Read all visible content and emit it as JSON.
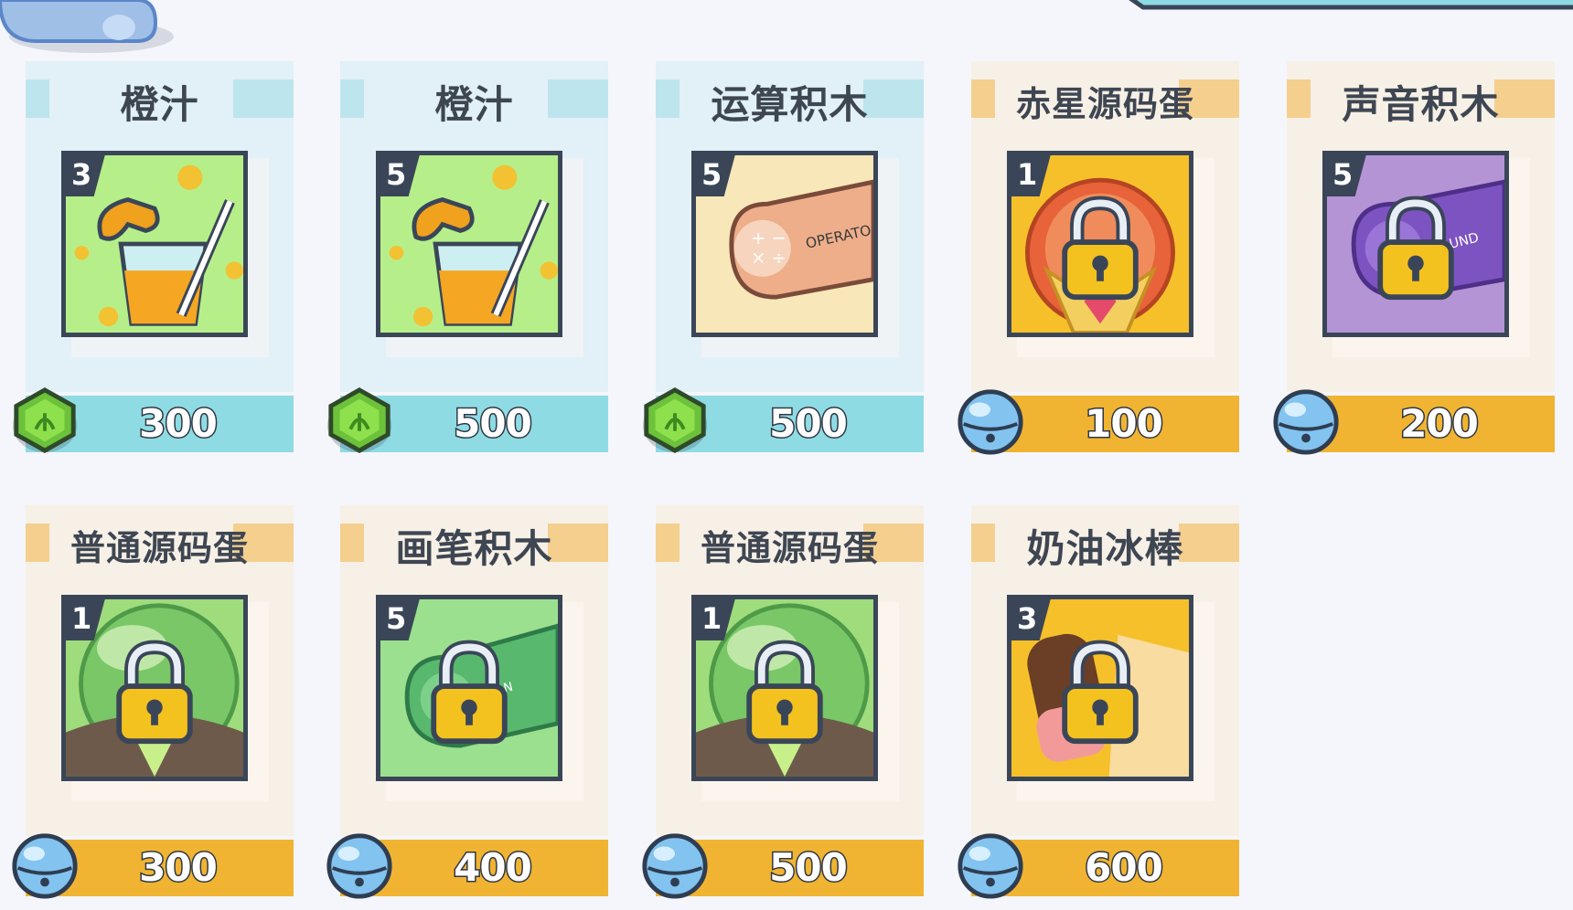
{
  "items": [
    {
      "name": "橙汁",
      "level": "3",
      "price": "300",
      "currency": "gem-icon",
      "theme": "blue",
      "art": "juice",
      "locked": false
    },
    {
      "name": "橙汁",
      "level": "5",
      "price": "500",
      "currency": "gem-icon",
      "theme": "blue",
      "art": "juice",
      "locked": false
    },
    {
      "name": "运算积木",
      "level": "5",
      "price": "500",
      "currency": "gem-icon",
      "theme": "blue",
      "art": "operator",
      "locked": false
    },
    {
      "name": "赤星源码蛋",
      "level": "1",
      "price": "100",
      "currency": "bell-icon",
      "theme": "cream",
      "art": "red-egg",
      "locked": true
    },
    {
      "name": "声音积木",
      "level": "5",
      "price": "200",
      "currency": "bell-icon",
      "theme": "cream",
      "art": "sound",
      "locked": true
    },
    {
      "name": "普通源码蛋",
      "level": "1",
      "price": "300",
      "currency": "bell-icon",
      "theme": "cream",
      "art": "green-egg",
      "locked": true
    },
    {
      "name": "画笔积木",
      "level": "5",
      "price": "400",
      "currency": "bell-icon",
      "theme": "cream",
      "art": "pen",
      "locked": true
    },
    {
      "name": "普通源码蛋",
      "level": "1",
      "price": "500",
      "currency": "bell-icon",
      "theme": "cream",
      "art": "green-egg",
      "locked": true
    },
    {
      "name": "奶油冰棒",
      "level": "3",
      "price": "600",
      "currency": "bell-icon",
      "theme": "cream",
      "art": "ice-cream",
      "locked": true
    }
  ],
  "colors": {
    "blue_panel": "#e2f0f7",
    "blue_bar": "#8fdbe4",
    "cream_panel": "#f7f0e6",
    "gold_bar": "#f0b432",
    "frame": "#3a4658"
  }
}
